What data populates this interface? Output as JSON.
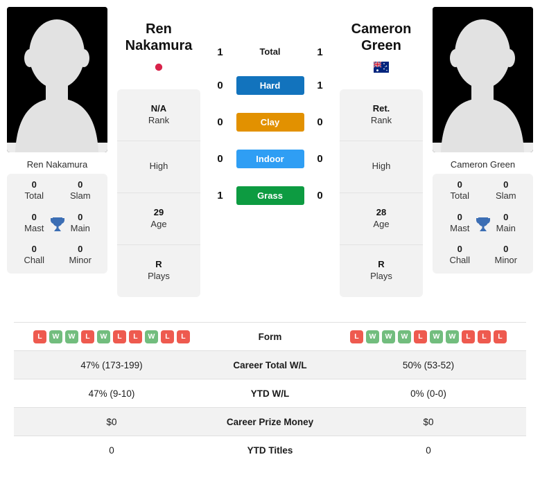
{
  "players": {
    "left": {
      "name_line1": "Ren",
      "name_line2": "Nakamura",
      "caption": "Ren Nakamura",
      "flag_icon": "japan-flag-icon",
      "rank_value": "N/A",
      "rank_label": "Rank",
      "high_value": "",
      "high_label": "High",
      "age_value": "29",
      "age_label": "Age",
      "plays_value": "R",
      "plays_label": "Plays",
      "titles": {
        "total_value": "0",
        "total_label": "Total",
        "slam_value": "0",
        "slam_label": "Slam",
        "mast_value": "0",
        "mast_label": "Mast",
        "main_value": "0",
        "main_label": "Main",
        "chall_value": "0",
        "chall_label": "Chall",
        "minor_value": "0",
        "minor_label": "Minor"
      },
      "form": [
        "L",
        "W",
        "W",
        "L",
        "W",
        "L",
        "L",
        "W",
        "L",
        "L"
      ],
      "career_wl": "47% (173-199)",
      "ytd_wl": "47% (9-10)",
      "career_prize": "$0",
      "ytd_titles": "0"
    },
    "right": {
      "name_line1": "Cameron",
      "name_line2": "Green",
      "caption": "Cameron Green",
      "flag_icon": "australia-flag-icon",
      "rank_value": "Ret.",
      "rank_label": "Rank",
      "high_value": "",
      "high_label": "High",
      "age_value": "28",
      "age_label": "Age",
      "plays_value": "R",
      "plays_label": "Plays",
      "titles": {
        "total_value": "0",
        "total_label": "Total",
        "slam_value": "0",
        "slam_label": "Slam",
        "mast_value": "0",
        "mast_label": "Mast",
        "main_value": "0",
        "main_label": "Main",
        "chall_value": "0",
        "chall_label": "Chall",
        "minor_value": "0",
        "minor_label": "Minor"
      },
      "form": [
        "L",
        "W",
        "W",
        "W",
        "L",
        "W",
        "W",
        "L",
        "L",
        "L"
      ],
      "career_wl": "50% (53-52)",
      "ytd_wl": "0% (0-0)",
      "career_prize": "$0",
      "ytd_titles": "0"
    }
  },
  "head_to_head": {
    "total": {
      "label": "Total",
      "left": "1",
      "right": "1"
    },
    "surfaces": [
      {
        "label": "Hard",
        "left": "0",
        "right": "1",
        "color": "#1273bd"
      },
      {
        "label": "Clay",
        "left": "0",
        "right": "0",
        "color": "#e29100"
      },
      {
        "label": "Indoor",
        "left": "0",
        "right": "0",
        "color": "#2f9ef4"
      },
      {
        "label": "Grass",
        "left": "1",
        "right": "0",
        "color": "#0d9b41"
      }
    ]
  },
  "stats_table": {
    "rows": [
      {
        "label": "Form",
        "type": "form"
      },
      {
        "label": "Career Total W/L",
        "type": "text",
        "left": "47% (173-199)",
        "right": "50% (53-52)"
      },
      {
        "label": "YTD W/L",
        "type": "text",
        "left": "47% (9-10)",
        "right": "0% (0-0)"
      },
      {
        "label": "Career Prize Money",
        "type": "text",
        "left": "$0",
        "right": "$0"
      },
      {
        "label": "YTD Titles",
        "type": "text",
        "left": "0",
        "right": "0"
      }
    ]
  },
  "colors": {
    "win": "#72bd7e",
    "loss": "#ee5a4f",
    "trophy": "#3c6eb4",
    "japan_red": "#d8234a",
    "card_bg": "#f2f2f2"
  }
}
